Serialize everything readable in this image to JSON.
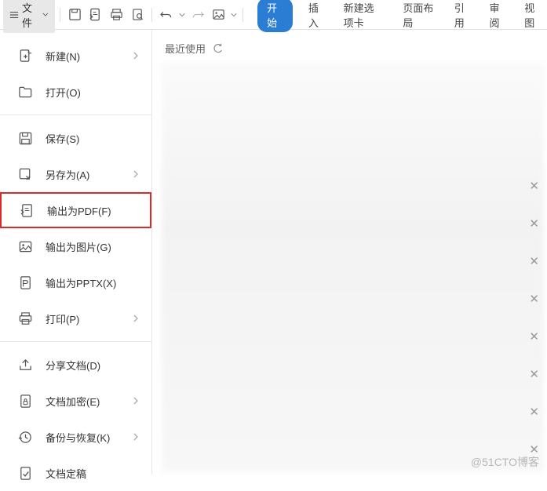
{
  "toolbar": {
    "file_label": "文件"
  },
  "tabs": {
    "start": "开始",
    "insert": "插入",
    "newtab": "新建选项卡",
    "pagelayout": "页面布局",
    "reference": "引用",
    "review": "审阅",
    "view": "视图"
  },
  "menu": {
    "new": "新建(N)",
    "open": "打开(O)",
    "save": "保存(S)",
    "saveas": "另存为(A)",
    "exportpdf": "输出为PDF(F)",
    "exportimg": "输出为图片(G)",
    "exportpptx": "输出为PPTX(X)",
    "print": "打印(P)",
    "share": "分享文档(D)",
    "encrypt": "文档加密(E)",
    "backup": "备份与恢复(K)",
    "finalize": "文档定稿"
  },
  "recent": {
    "label": "最近使用"
  },
  "watermark": "@51CTO博客"
}
